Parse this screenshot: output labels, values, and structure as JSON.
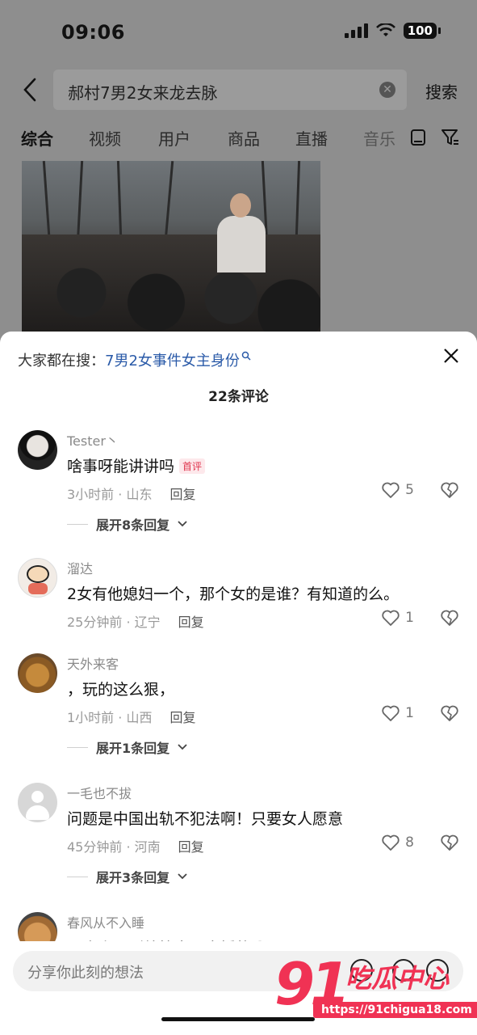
{
  "status_bar": {
    "time": "09:06",
    "battery": "100"
  },
  "search": {
    "query": "郝村7男2女来龙去脉",
    "search_label": "搜索"
  },
  "tabs": [
    {
      "label": "综合"
    },
    {
      "label": "视频"
    },
    {
      "label": "用户"
    },
    {
      "label": "商品"
    },
    {
      "label": "直播"
    },
    {
      "label": "音乐"
    }
  ],
  "sheet": {
    "suggest_prefix": "大家都在搜：",
    "suggest_link": "7男2女事件女主身份",
    "comment_count": "22条评论"
  },
  "comments": [
    {
      "name": "Tester丶",
      "text": "啥事呀能讲讲吗",
      "badge": "首评",
      "time_loc": "3小时前 · 山东",
      "reply": "回复",
      "likes": "5",
      "expand": "展开8条回复"
    },
    {
      "name": "溜达",
      "text": "2女有他媳妇一个，那个女的是谁？有知道的么。",
      "time_loc": "25分钟前 · 辽宁",
      "reply": "回复",
      "likes": "1"
    },
    {
      "name": "天外来客",
      "text": "，玩的这么狠，",
      "time_loc": "1小时前 · 山西",
      "reply": "回复",
      "likes": "1",
      "expand": "展开1条回复"
    },
    {
      "name": "一毛也不拔",
      "text": "问题是中国出轨不犯法啊！只要女人愿意",
      "time_loc": "45分钟前 · 河南",
      "reply": "回复",
      "likes": "8",
      "expand": "展开3条回复"
    },
    {
      "name": "春风从不入睡",
      "text": "不会小区到处搞定，直播的😂"
    }
  ],
  "input": {
    "placeholder": "分享你此刻的想法"
  },
  "watermark": {
    "number": "91",
    "title": "吃瓜中心",
    "url": "https://91chigua18.com"
  },
  "colors": {
    "link": "#2a5aa8",
    "badge": "#e0364f",
    "watermark": "#f03254"
  }
}
